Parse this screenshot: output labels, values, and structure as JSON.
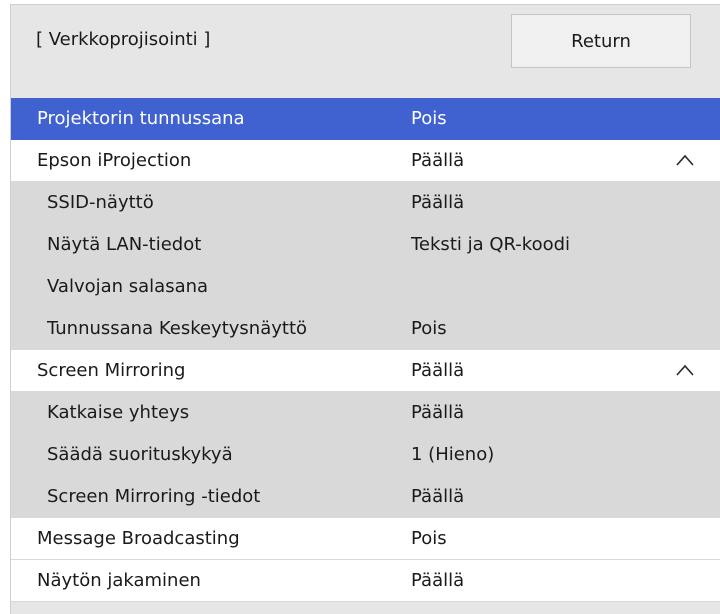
{
  "header": {
    "title": "[ Verkkoprojisointi ]",
    "return_label": "Return"
  },
  "menu": {
    "items": [
      {
        "label": "Projektorin tunnussana",
        "value": "Pois",
        "selected": true
      },
      {
        "label": "Epson iProjection",
        "value": "Päällä",
        "expanded": true
      },
      {
        "label": "SSID-näyttö",
        "value": "Päällä"
      },
      {
        "label": "Näytä LAN-tiedot",
        "value": "Teksti ja QR-koodi"
      },
      {
        "label": "Valvojan salasana",
        "value": ""
      },
      {
        "label": "Tunnussana Keskeytysnäyttö",
        "value": "Pois"
      },
      {
        "label": "Screen Mirroring",
        "value": "Päällä",
        "expanded": true
      },
      {
        "label": "Katkaise yhteys",
        "value": "Päällä"
      },
      {
        "label": "Säädä suorituskykyä",
        "value": "1 (Hieno)"
      },
      {
        "label": "Screen Mirroring -tiedot",
        "value": "Päällä"
      },
      {
        "label": "Message Broadcasting",
        "value": "Pois"
      },
      {
        "label": "Näytön jakaminen",
        "value": "Päällä"
      }
    ]
  },
  "colors": {
    "selection": "#3f62d0",
    "panel": "#e6e6e6",
    "submenu": "#d9d9d9"
  },
  "icons": {
    "expand": "chevron-up-icon"
  }
}
